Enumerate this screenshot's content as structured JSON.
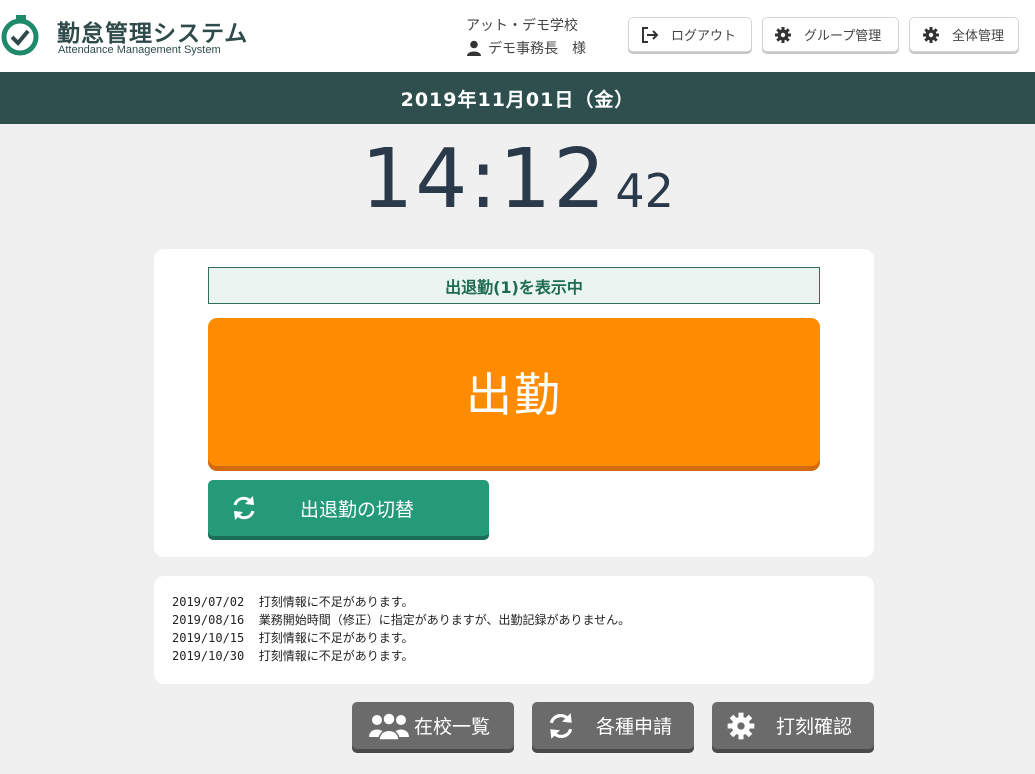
{
  "header": {
    "title": "勤怠管理システム",
    "subtitle": "Attendance Management System",
    "school": "アット・デモ学校",
    "user": "デモ事務長　様",
    "logout_label": "ログアウト",
    "group_admin_label": "グループ管理",
    "all_admin_label": "全体管理"
  },
  "date_bar": {
    "text": "2019年11月01日（金）"
  },
  "clock": {
    "hm": "14:12",
    "sec": "42"
  },
  "panel": {
    "mode_label": "出退勤(1)を表示中",
    "punch_label": "出勤",
    "toggle_label": "出退勤の切替"
  },
  "notices": [
    {
      "date": "2019/07/02",
      "text": "打刻情報に不足があります。"
    },
    {
      "date": "2019/08/16",
      "text": "業務開始時間（修正）に指定がありますが、出勤記録がありません。"
    },
    {
      "date": "2019/10/15",
      "text": "打刻情報に不足があります。"
    },
    {
      "date": "2019/10/30",
      "text": "打刻情報に不足があります。"
    }
  ],
  "footer": {
    "present_label": "在校一覧",
    "requests_label": "各種申請",
    "records_label": "打刻確認"
  },
  "colors": {
    "header_bar": "#2f4f4f",
    "punch_button": "#ff8c00",
    "toggle_button": "#259a78",
    "footer_button": "#6b6b6b"
  },
  "icons": {
    "logo": "clock-check-icon",
    "user": "user-icon",
    "logout": "logout-icon",
    "gear": "gear-icon",
    "switch": "sync-icon",
    "people": "users-icon"
  }
}
